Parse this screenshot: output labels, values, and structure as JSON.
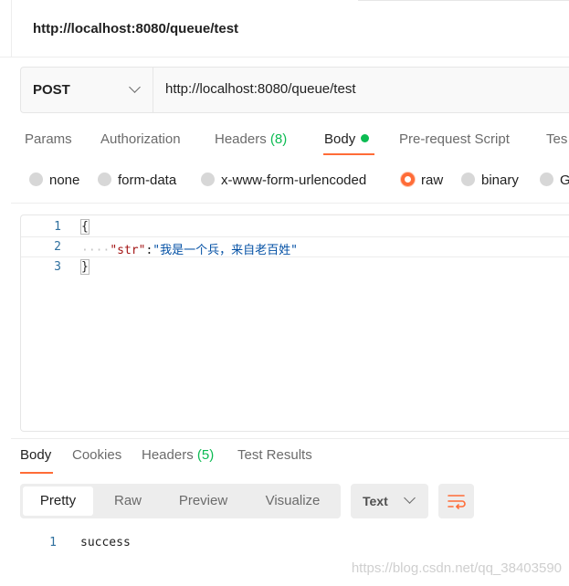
{
  "request": {
    "title": "http://localhost:8080/queue/test",
    "method": "POST",
    "url": "http://localhost:8080/queue/test"
  },
  "request_tabs": [
    {
      "label": "Params"
    },
    {
      "label": "Authorization"
    },
    {
      "label": "Headers",
      "count": "(8)"
    },
    {
      "label": "Body"
    },
    {
      "label": "Pre-request Script"
    },
    {
      "label": "Tes"
    }
  ],
  "body_types": [
    {
      "label": "none"
    },
    {
      "label": "form-data"
    },
    {
      "label": "x-www-form-urlencoded"
    },
    {
      "label": "raw"
    },
    {
      "label": "binary"
    },
    {
      "label": "G"
    }
  ],
  "editor": {
    "lines": [
      {
        "num": "1",
        "text": "{"
      },
      {
        "num": "2",
        "indent": "····",
        "key": "\"str\"",
        "colon": ":",
        "value": "\"我是一个兵，来自老百姓\""
      },
      {
        "num": "3",
        "text": "}"
      }
    ]
  },
  "response_tabs": [
    {
      "label": "Body"
    },
    {
      "label": "Cookies"
    },
    {
      "label": "Headers",
      "count": "(5)"
    },
    {
      "label": "Test Results"
    }
  ],
  "view_modes": [
    {
      "label": "Pretty"
    },
    {
      "label": "Raw"
    },
    {
      "label": "Preview"
    },
    {
      "label": "Visualize"
    }
  ],
  "format": {
    "selected": "Text"
  },
  "response": {
    "lines": [
      {
        "num": "1",
        "text": "success"
      }
    ]
  },
  "watermark": "https://blog.csdn.net/qq_38403590",
  "colors": {
    "accent": "#ff6c37",
    "green": "#0cbb52"
  },
  "icons": [
    "chevron-down-icon",
    "status-dot-icon",
    "wrap-lines-icon"
  ]
}
